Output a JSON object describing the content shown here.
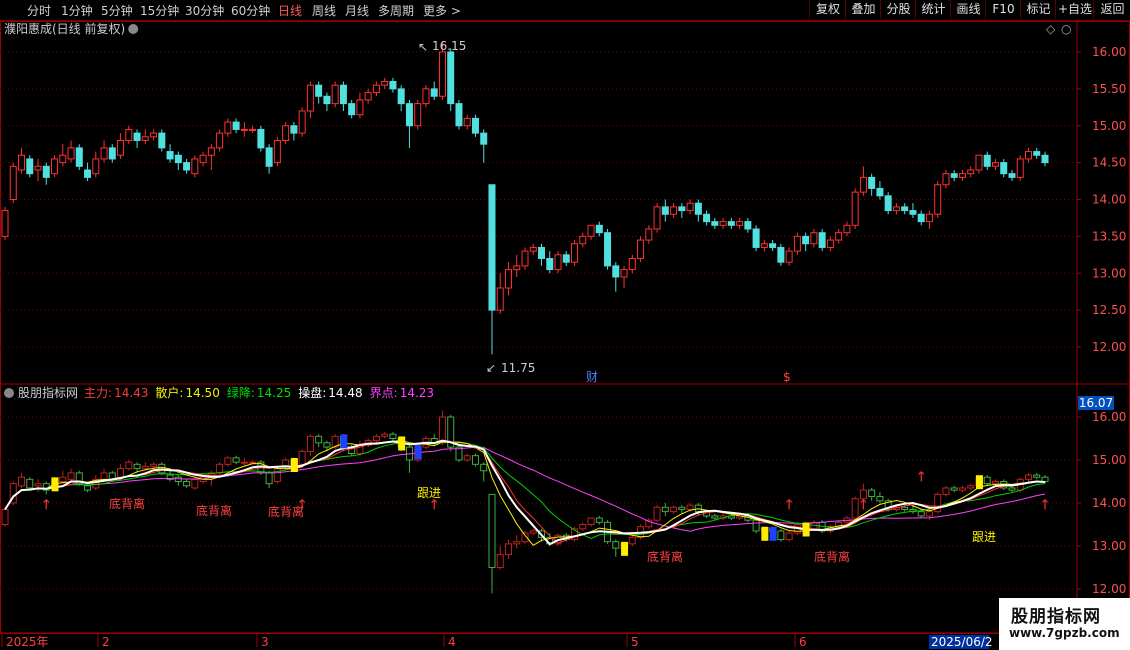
{
  "toolbar": {
    "periods": [
      "分时",
      "1分钟",
      "5分钟",
      "15分钟",
      "30分钟",
      "60分钟",
      "日线",
      "周线",
      "月线",
      "多周期",
      "更多 >"
    ],
    "active_period": "日线",
    "buttons": [
      "复权",
      "叠加",
      "分股",
      "统计",
      "画线",
      "F10",
      "标记",
      "+自选",
      "返回"
    ]
  },
  "main_panel": {
    "title": "濮阳惠成(日线 前复权)",
    "high_label": "16.15",
    "low_label": "11.75",
    "markers": [
      "财",
      "$"
    ],
    "yticks": [
      "16.00",
      "15.50",
      "15.00",
      "14.50",
      "14.00",
      "13.50",
      "13.00",
      "12.50",
      "12.00"
    ]
  },
  "indicator_panel": {
    "name": "股朋指标网",
    "values": [
      {
        "label": "主力:",
        "value": "14.43",
        "color": "#ff3b3b"
      },
      {
        "label": "散户:",
        "value": "14.50",
        "color": "#f0f000"
      },
      {
        "label": "绿降:",
        "value": "14.25",
        "color": "#00e000"
      },
      {
        "label": "操盘:",
        "value": "14.48",
        "color": "#ffffff"
      },
      {
        "label": "界点:",
        "value": "14.23",
        "color": "#ff40ff"
      }
    ],
    "current_badge": "16.07",
    "yticks": [
      "16.00",
      "15.00",
      "14.00",
      "13.00",
      "12.00"
    ],
    "signal_texts": [
      "底背离",
      "底背离",
      "底背离",
      "跟进",
      "底背离",
      "底背离",
      "跟进"
    ]
  },
  "xaxis": {
    "labels": [
      "2025年",
      "2",
      "3",
      "4",
      "5",
      "6"
    ],
    "current_date": "2025/06/2"
  },
  "watermark": {
    "name": "股朋指标网",
    "url": "www.7gpzb.com"
  },
  "colors": {
    "up": "#ff3030",
    "down": "#50e0e0",
    "grid": "#7a0000",
    "frame": "#a00000",
    "axis_text": "#ff5050"
  },
  "chart_data": {
    "type": "candlestick",
    "title": "濮阳惠成(日线 前复权)",
    "xlabel": "",
    "ylabel": "",
    "ylim": [
      11.6,
      16.4
    ],
    "candles": [
      [
        13.5,
        13.85,
        13.45,
        13.9
      ],
      [
        14.0,
        14.45,
        13.95,
        14.5
      ],
      [
        14.4,
        14.6,
        14.35,
        14.7
      ],
      [
        14.55,
        14.35,
        14.3,
        14.6
      ],
      [
        14.4,
        14.45,
        14.25,
        14.55
      ],
      [
        14.45,
        14.3,
        14.2,
        14.5
      ],
      [
        14.35,
        14.55,
        14.3,
        14.6
      ],
      [
        14.5,
        14.6,
        14.45,
        14.75
      ],
      [
        14.55,
        14.7,
        14.5,
        14.8
      ],
      [
        14.7,
        14.45,
        14.4,
        14.75
      ],
      [
        14.4,
        14.3,
        14.25,
        14.5
      ],
      [
        14.35,
        14.55,
        14.3,
        14.65
      ],
      [
        14.55,
        14.7,
        14.5,
        14.8
      ],
      [
        14.7,
        14.55,
        14.5,
        14.75
      ],
      [
        14.6,
        14.8,
        14.55,
        14.9
      ],
      [
        14.8,
        14.95,
        14.75,
        15.0
      ],
      [
        14.9,
        14.8,
        14.7,
        14.95
      ],
      [
        14.8,
        14.85,
        14.75,
        14.95
      ],
      [
        14.85,
        14.9,
        14.8,
        14.95
      ],
      [
        14.9,
        14.7,
        14.65,
        14.95
      ],
      [
        14.65,
        14.55,
        14.5,
        14.75
      ],
      [
        14.6,
        14.5,
        14.4,
        14.65
      ],
      [
        14.5,
        14.4,
        14.35,
        14.55
      ],
      [
        14.35,
        14.55,
        14.3,
        14.6
      ],
      [
        14.5,
        14.6,
        14.45,
        14.65
      ],
      [
        14.6,
        14.7,
        14.4,
        14.75
      ],
      [
        14.7,
        14.9,
        14.65,
        14.95
      ],
      [
        14.9,
        15.05,
        14.85,
        15.1
      ],
      [
        15.05,
        14.95,
        14.9,
        15.1
      ],
      [
        14.95,
        14.95,
        14.85,
        15.05
      ],
      [
        14.95,
        14.95,
        14.9,
        15.0
      ],
      [
        14.95,
        14.7,
        14.65,
        15.0
      ],
      [
        14.7,
        14.45,
        14.35,
        14.75
      ],
      [
        14.5,
        14.8,
        14.45,
        14.85
      ],
      [
        14.8,
        15.0,
        14.75,
        15.05
      ],
      [
        15.0,
        14.9,
        14.8,
        15.05
      ],
      [
        14.9,
        15.2,
        14.85,
        15.25
      ],
      [
        15.2,
        15.55,
        15.1,
        15.6
      ],
      [
        15.55,
        15.4,
        15.3,
        15.6
      ],
      [
        15.4,
        15.3,
        15.2,
        15.45
      ],
      [
        15.3,
        15.55,
        15.25,
        15.6
      ],
      [
        15.55,
        15.3,
        15.2,
        15.6
      ],
      [
        15.3,
        15.15,
        15.1,
        15.35
      ],
      [
        15.15,
        15.35,
        15.1,
        15.45
      ],
      [
        15.35,
        15.45,
        15.3,
        15.5
      ],
      [
        15.45,
        15.55,
        15.4,
        15.6
      ],
      [
        15.55,
        15.6,
        15.5,
        15.65
      ],
      [
        15.6,
        15.5,
        15.45,
        15.65
      ],
      [
        15.5,
        15.3,
        15.2,
        15.55
      ],
      [
        15.3,
        15.0,
        14.7,
        15.35
      ],
      [
        15.0,
        15.3,
        14.95,
        15.35
      ],
      [
        15.3,
        15.5,
        15.25,
        15.55
      ],
      [
        15.5,
        15.4,
        15.35,
        15.6
      ],
      [
        15.4,
        16.0,
        15.35,
        16.15
      ],
      [
        16.0,
        15.3,
        15.2,
        16.05
      ],
      [
        15.3,
        15.0,
        14.95,
        15.35
      ],
      [
        15.0,
        15.1,
        14.95,
        15.15
      ],
      [
        15.1,
        14.9,
        14.85,
        15.15
      ],
      [
        14.9,
        14.75,
        14.5,
        14.95
      ],
      [
        14.2,
        12.5,
        11.9,
        14.2
      ],
      [
        12.5,
        12.8,
        12.45,
        13.0
      ],
      [
        12.8,
        13.05,
        12.7,
        13.15
      ],
      [
        13.05,
        13.1,
        12.95,
        13.25
      ],
      [
        13.1,
        13.3,
        13.05,
        13.35
      ],
      [
        13.3,
        13.35,
        13.25,
        13.4
      ],
      [
        13.35,
        13.2,
        13.1,
        13.4
      ],
      [
        13.2,
        13.05,
        13.0,
        13.3
      ],
      [
        13.05,
        13.25,
        13.0,
        13.3
      ],
      [
        13.25,
        13.15,
        13.1,
        13.3
      ],
      [
        13.15,
        13.4,
        13.1,
        13.45
      ],
      [
        13.4,
        13.5,
        13.35,
        13.55
      ],
      [
        13.5,
        13.65,
        13.45,
        13.65
      ],
      [
        13.65,
        13.55,
        13.5,
        13.7
      ],
      [
        13.55,
        13.1,
        13.05,
        13.6
      ],
      [
        13.1,
        12.95,
        12.75,
        13.15
      ],
      [
        12.95,
        13.05,
        12.8,
        13.1
      ],
      [
        13.05,
        13.2,
        13.0,
        13.25
      ],
      [
        13.2,
        13.45,
        13.15,
        13.5
      ],
      [
        13.45,
        13.6,
        13.4,
        13.65
      ],
      [
        13.6,
        13.9,
        13.55,
        13.95
      ],
      [
        13.9,
        13.8,
        13.7,
        14.0
      ],
      [
        13.8,
        13.9,
        13.75,
        13.95
      ],
      [
        13.9,
        13.85,
        13.75,
        13.95
      ],
      [
        13.85,
        13.95,
        13.8,
        14.0
      ],
      [
        13.95,
        13.8,
        13.7,
        14.0
      ],
      [
        13.8,
        13.7,
        13.65,
        13.85
      ],
      [
        13.7,
        13.65,
        13.6,
        13.75
      ],
      [
        13.65,
        13.7,
        13.6,
        13.75
      ],
      [
        13.7,
        13.65,
        13.6,
        13.75
      ],
      [
        13.65,
        13.7,
        13.6,
        13.75
      ],
      [
        13.7,
        13.6,
        13.55,
        13.75
      ],
      [
        13.6,
        13.35,
        13.3,
        13.65
      ],
      [
        13.35,
        13.4,
        13.3,
        13.45
      ],
      [
        13.4,
        13.35,
        13.3,
        13.45
      ],
      [
        13.35,
        13.15,
        13.1,
        13.4
      ],
      [
        13.15,
        13.3,
        13.1,
        13.35
      ],
      [
        13.3,
        13.5,
        13.25,
        13.55
      ],
      [
        13.5,
        13.4,
        13.3,
        13.55
      ],
      [
        13.4,
        13.55,
        13.35,
        13.6
      ],
      [
        13.55,
        13.35,
        13.3,
        13.6
      ],
      [
        13.35,
        13.45,
        13.3,
        13.5
      ],
      [
        13.45,
        13.55,
        13.4,
        13.6
      ],
      [
        13.55,
        13.65,
        13.5,
        13.7
      ],
      [
        13.65,
        14.1,
        13.6,
        14.15
      ],
      [
        14.1,
        14.3,
        14.05,
        14.45
      ],
      [
        14.3,
        14.15,
        14.05,
        14.35
      ],
      [
        14.15,
        14.05,
        14.0,
        14.25
      ],
      [
        14.05,
        13.85,
        13.8,
        14.1
      ],
      [
        13.85,
        13.9,
        13.8,
        13.95
      ],
      [
        13.9,
        13.85,
        13.8,
        13.95
      ],
      [
        13.85,
        13.8,
        13.75,
        13.95
      ],
      [
        13.8,
        13.7,
        13.65,
        13.85
      ],
      [
        13.7,
        13.8,
        13.6,
        13.85
      ],
      [
        13.8,
        14.2,
        13.75,
        14.25
      ],
      [
        14.2,
        14.35,
        14.15,
        14.4
      ],
      [
        14.35,
        14.3,
        14.25,
        14.4
      ],
      [
        14.3,
        14.35,
        14.25,
        14.4
      ],
      [
        14.35,
        14.4,
        14.3,
        14.45
      ],
      [
        14.4,
        14.6,
        14.35,
        14.6
      ],
      [
        14.6,
        14.45,
        14.4,
        14.65
      ],
      [
        14.45,
        14.5,
        14.4,
        14.55
      ],
      [
        14.5,
        14.35,
        14.3,
        14.55
      ],
      [
        14.35,
        14.3,
        14.25,
        14.4
      ],
      [
        14.3,
        14.55,
        14.25,
        14.6
      ],
      [
        14.55,
        14.65,
        14.5,
        14.7
      ],
      [
        14.65,
        14.6,
        14.55,
        14.7
      ],
      [
        14.6,
        14.5,
        14.45,
        14.65
      ]
    ]
  }
}
